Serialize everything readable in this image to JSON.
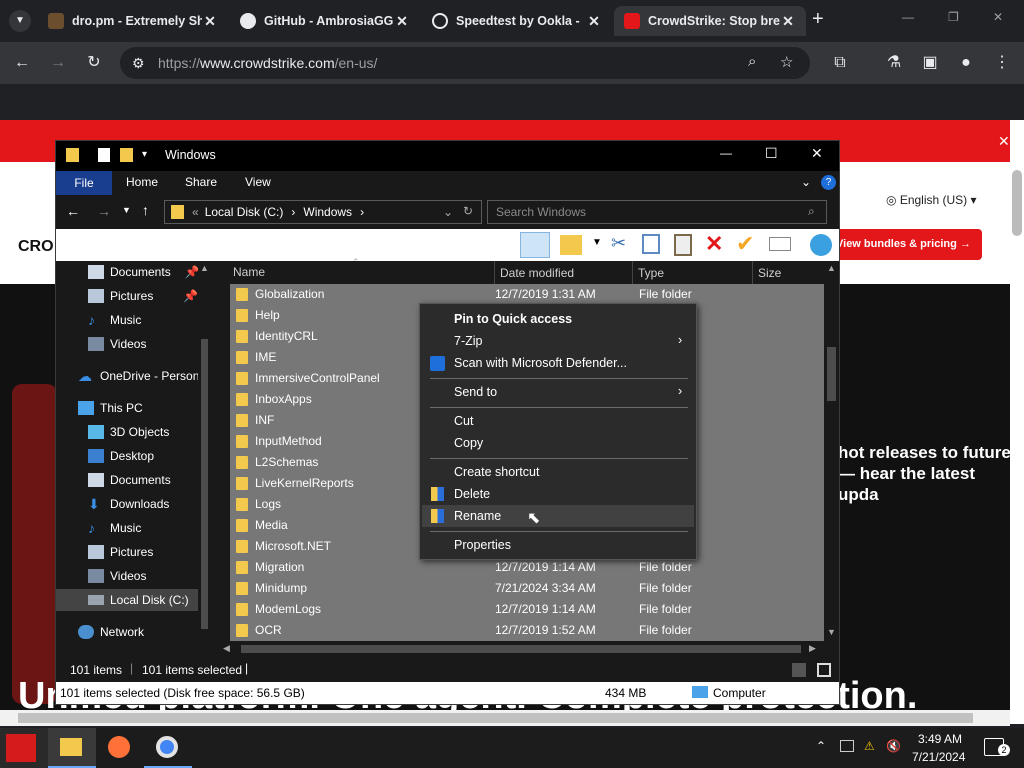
{
  "browser": {
    "tabs": [
      {
        "title": "dro.pm - Extremely Sh",
        "active": false
      },
      {
        "title": "GitHub - AmbrosiaGG",
        "active": false
      },
      {
        "title": "Speedtest by Ookla -",
        "active": false
      },
      {
        "title": "CrowdStrike: Stop bre",
        "active": true
      }
    ],
    "url_prefix": "https://",
    "url_host": "www.crowdstrike.com",
    "url_path": "/en-us/",
    "new_tab": "+"
  },
  "website": {
    "language": "English (US)",
    "pricing_button": "View bundles & pricing →",
    "hero_line1": "hot releases to future",
    "hero_line2": "— hear the latest upda",
    "hero_big": "Unified platform. One agent. Complete protection."
  },
  "explorer": {
    "title": "Windows",
    "ribbon_tabs": [
      "File",
      "Home",
      "Share",
      "View"
    ],
    "breadcrumb": [
      "Local Disk (C:)",
      "Windows"
    ],
    "search_placeholder": "Search Windows",
    "columns": [
      "Name",
      "Date modified",
      "Type",
      "Size"
    ],
    "nav": {
      "items": [
        {
          "label": "Documents",
          "pin": true
        },
        {
          "label": "Pictures",
          "pin": true
        },
        {
          "label": "Music",
          "pin": false
        },
        {
          "label": "Videos",
          "pin": false
        },
        {
          "label": "OneDrive - Person",
          "pin": false
        },
        {
          "label": "This PC",
          "pin": false
        },
        {
          "label": "3D Objects",
          "pin": false
        },
        {
          "label": "Desktop",
          "pin": false
        },
        {
          "label": "Documents",
          "pin": false
        },
        {
          "label": "Downloads",
          "pin": false
        },
        {
          "label": "Music",
          "pin": false
        },
        {
          "label": "Pictures",
          "pin": false
        },
        {
          "label": "Videos",
          "pin": false
        },
        {
          "label": "Local Disk (C:)",
          "pin": false
        },
        {
          "label": "Network",
          "pin": false
        }
      ]
    },
    "rows": [
      {
        "name": "Globalization",
        "date": "12/7/2019 1:31 AM",
        "type": "File folder"
      },
      {
        "name": "Help",
        "date": "",
        "type": ""
      },
      {
        "name": "IdentityCRL",
        "date": "",
        "type": ""
      },
      {
        "name": "IME",
        "date": "",
        "type": ""
      },
      {
        "name": "ImmersiveControlPanel",
        "date": "",
        "type": ""
      },
      {
        "name": "InboxApps",
        "date": "",
        "type": ""
      },
      {
        "name": "INF",
        "date": "",
        "type": ""
      },
      {
        "name": "InputMethod",
        "date": "",
        "type": ""
      },
      {
        "name": "L2Schemas",
        "date": "",
        "type": ""
      },
      {
        "name": "LiveKernelReports",
        "date": "",
        "type": ""
      },
      {
        "name": "Logs",
        "date": "",
        "type": ""
      },
      {
        "name": "Media",
        "date": "",
        "type": ""
      },
      {
        "name": "Microsoft.NET",
        "date": "",
        "type": ""
      },
      {
        "name": "Migration",
        "date": "12/7/2019 1:14 AM",
        "type": "File folder"
      },
      {
        "name": "Minidump",
        "date": "7/21/2024 3:34 AM",
        "type": "File folder"
      },
      {
        "name": "ModemLogs",
        "date": "12/7/2019 1:14 AM",
        "type": "File folder"
      },
      {
        "name": "OCR",
        "date": "12/7/2019 1:52 AM",
        "type": "File folder"
      }
    ],
    "status_items": "101 items",
    "status_selected": "101 items selected",
    "foot_selection": "101 items selected (Disk free space: 56.5 GB)",
    "foot_size": "434 MB",
    "foot_location": "Computer"
  },
  "context_menu": {
    "items": [
      {
        "label": "Pin to Quick access",
        "bold": true
      },
      {
        "label": "7-Zip",
        "submenu": true
      },
      {
        "label": "Scan with Microsoft Defender...",
        "icon": "defender-icon"
      },
      {
        "label": "Send to",
        "submenu": true
      },
      {
        "label": "Cut"
      },
      {
        "label": "Copy"
      },
      {
        "label": "Create shortcut"
      },
      {
        "label": "Delete",
        "icon": "shield-icon"
      },
      {
        "label": "Rename",
        "icon": "shield-icon",
        "highlighted": true
      },
      {
        "label": "Properties"
      }
    ]
  },
  "taskbar": {
    "time": "3:49 AM",
    "date": "7/21/2024",
    "notifications": "2"
  },
  "colors": {
    "accent_red": "#e3161a",
    "file_tab_blue": "#1a3e8f",
    "folder_yellow": "#f2c94c"
  }
}
